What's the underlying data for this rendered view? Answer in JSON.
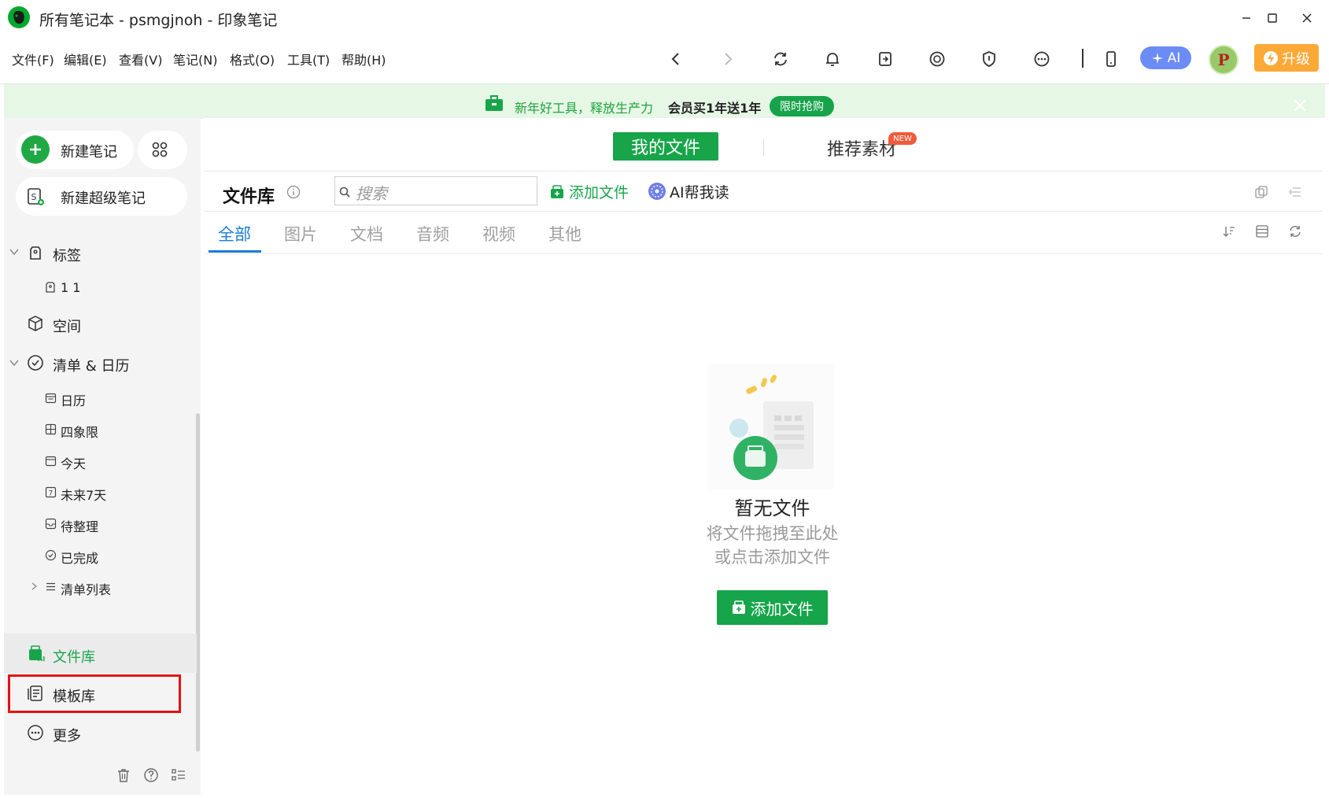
{
  "window": {
    "title": "所有笔记本 - psmgjnoh - 印象笔记"
  },
  "menu": [
    "文件(F)",
    "编辑(E)",
    "查看(V)",
    "笔记(N)",
    "格式(O)",
    "工具(T)",
    "帮助(H)"
  ],
  "toolbar": {
    "ai_label": "AI",
    "upgrade_label": "升级",
    "avatar_letter": "P"
  },
  "banner": {
    "text_green": "新年好工具，释放生产力",
    "text_bold": "会员买1年送1年",
    "pill": "限时抢购"
  },
  "sidebar": {
    "new_note": "新建笔记",
    "new_super_note": "新建超级笔记",
    "tags": "标签",
    "tag_item": "1  1",
    "space": "空间",
    "checklist_calendar": "清单 & 日历",
    "calendar_items": [
      "日历",
      "四象限",
      "今天",
      "未来7天",
      "待整理",
      "已完成",
      "清单列表"
    ],
    "file_library": "文件库",
    "template_library": "模板库",
    "more": "更多"
  },
  "main": {
    "tab_my_files": "我的文件",
    "tab_recommend": "推荐素材",
    "new_badge": "NEW",
    "library_title": "文件库",
    "search_placeholder": "搜索",
    "add_file": "添加文件",
    "ai_read": "AI帮我读",
    "filter_tabs": [
      "全部",
      "图片",
      "文档",
      "音频",
      "视频",
      "其他"
    ],
    "active_filter": "全部",
    "empty_title": "暂无文件",
    "empty_hint1": "将文件拖拽至此处",
    "empty_hint2": "或点击添加文件",
    "empty_button": "添加文件"
  },
  "colors": {
    "brand_green": "#18a54a",
    "active_tab_blue": "#1a7bd8",
    "upgrade_orange": "#fda937",
    "ai_blue": "#6c8cf5",
    "highlight_red": "#e21313",
    "banner_bg": "#e6f7e6"
  },
  "icons": {
    "toolbar": [
      "back-icon",
      "forward-icon",
      "sync-icon",
      "bell-icon",
      "share-icon",
      "smile-icon",
      "shield-icon",
      "more-icon",
      "phone-icon"
    ],
    "sidebar": [
      "tag-icon",
      "cube-icon",
      "check-circle-icon",
      "calendar-icon",
      "grid-icon",
      "today-icon",
      "seven-days-icon",
      "inbox-icon",
      "done-icon",
      "list-icon",
      "file-library-icon",
      "template-icon",
      "more-circle-icon",
      "trash-icon",
      "help-icon",
      "settings-list-icon"
    ]
  }
}
